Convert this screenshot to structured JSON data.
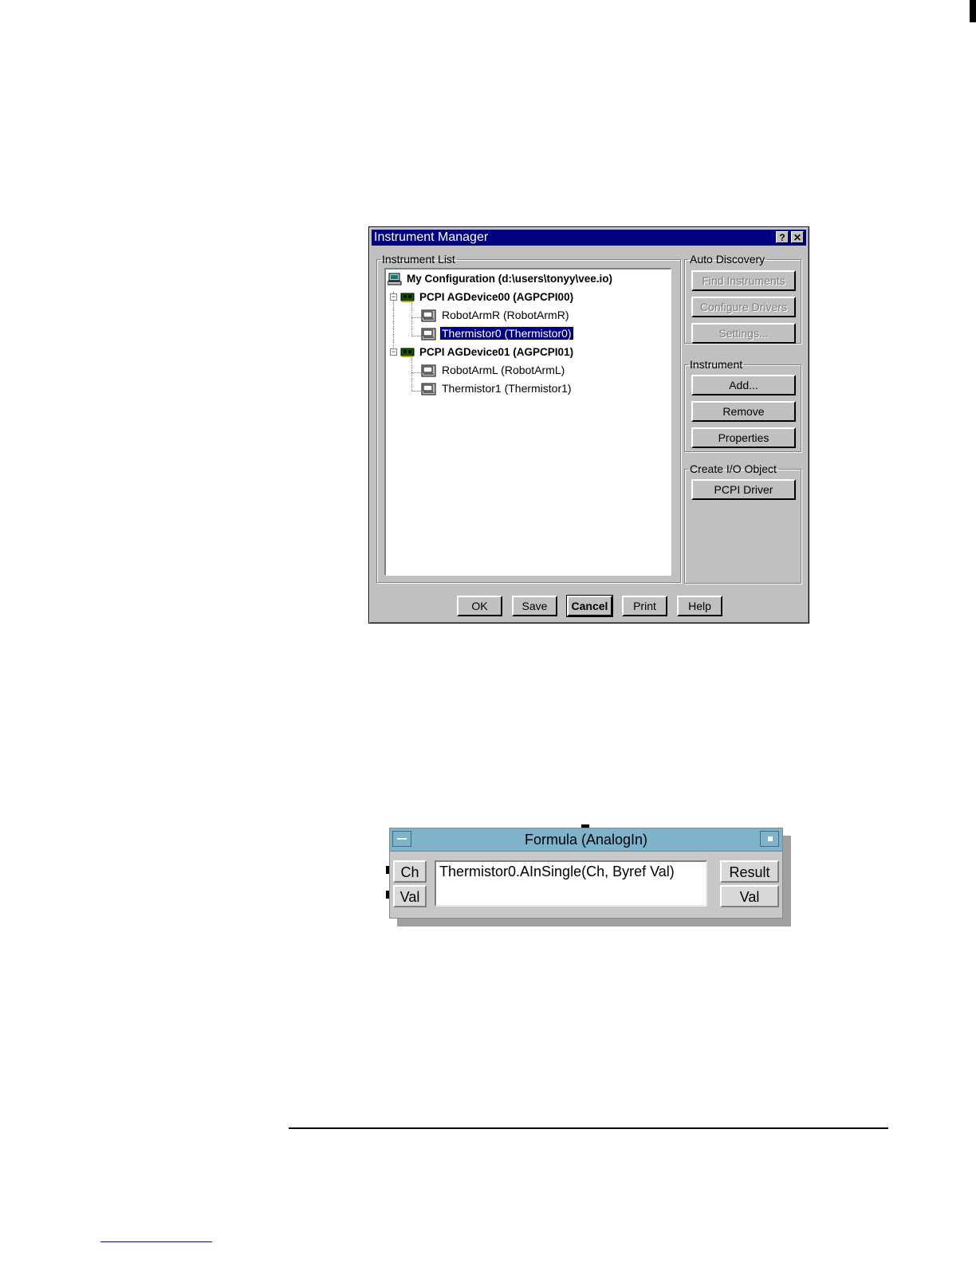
{
  "dialog": {
    "title": "Instrument Manager",
    "help_glyph": "?",
    "close_glyph": "✕",
    "instrument_list": {
      "legend": "Instrument List",
      "tree": [
        {
          "label": "My Configuration (d:\\users\\tonyy\\vee.io)",
          "icon": "computer-icon",
          "bold": true
        },
        {
          "label": "PCPI AGDevice00 (AGPCPI00)",
          "icon": "board-icon",
          "bold": true
        },
        {
          "label": "RobotArmR (RobotArmR)",
          "icon": "instrument-icon"
        },
        {
          "label": "Thermistor0 (Thermistor0)",
          "icon": "instrument-icon",
          "selected": true
        },
        {
          "label": "PCPI AGDevice01 (AGPCPI01)",
          "icon": "board-icon",
          "bold": true
        },
        {
          "label": "RobotArmL (RobotArmL)",
          "icon": "instrument-icon"
        },
        {
          "label": "Thermistor1 (Thermistor1)",
          "icon": "instrument-icon"
        }
      ],
      "expander_glyph": "−"
    },
    "auto_discovery": {
      "legend": "Auto Discovery",
      "find_label": "Find Instruments",
      "configure_label": "Configure Drivers",
      "settings_label": "Settings..."
    },
    "instrument": {
      "legend": "Instrument",
      "add_label": "Add...",
      "remove_label": "Remove",
      "properties_label": "Properties"
    },
    "create_io": {
      "legend": "Create I/O Object",
      "pcpi_label": "PCPI Driver"
    },
    "buttons": {
      "ok": "OK",
      "save": "Save",
      "cancel": "Cancel",
      "print": "Print",
      "help": "Help"
    }
  },
  "formula_object": {
    "title": "Formula (AnalogIn)",
    "inputs": [
      "Ch",
      "Val"
    ],
    "outputs": [
      "Result",
      "Val"
    ],
    "expression": "Thermistor0.AInSingle(Ch, Byref Val)"
  }
}
